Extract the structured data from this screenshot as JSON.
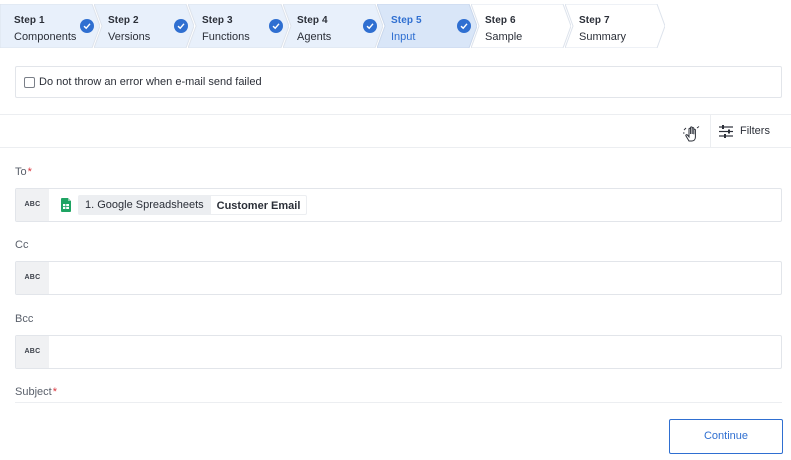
{
  "stepper": {
    "steps": [
      {
        "num": "Step 1",
        "name": "Components",
        "state": "done"
      },
      {
        "num": "Step 2",
        "name": "Versions",
        "state": "done"
      },
      {
        "num": "Step 3",
        "name": "Functions",
        "state": "done"
      },
      {
        "num": "Step 4",
        "name": "Agents",
        "state": "done"
      },
      {
        "num": "Step 5",
        "name": "Input",
        "state": "active"
      },
      {
        "num": "Step 6",
        "name": "Sample",
        "state": "pending"
      },
      {
        "num": "Step 7",
        "name": "Summary",
        "state": "pending"
      }
    ]
  },
  "options": {
    "no_throw_label": "Do not throw an error when e-mail send failed",
    "no_throw_checked": false
  },
  "toolbar": {
    "filters_label": "Filters"
  },
  "fields": {
    "to": {
      "label": "To",
      "required_mark": "*",
      "type_badge": "ABC",
      "chip": {
        "source": "1. Google Spreadsheets",
        "column": "Customer Email"
      }
    },
    "cc": {
      "label": "Cc",
      "type_badge": "ABC"
    },
    "bcc": {
      "label": "Bcc",
      "type_badge": "ABC"
    },
    "subject": {
      "label": "Subject",
      "required_mark": "*"
    }
  },
  "footer": {
    "continue_label": "Continue"
  },
  "colors": {
    "accent": "#2f6fd1",
    "done_step_bg": "#e8f0fb",
    "active_step_bg": "#d9e6f8",
    "required": "#d9363e"
  }
}
